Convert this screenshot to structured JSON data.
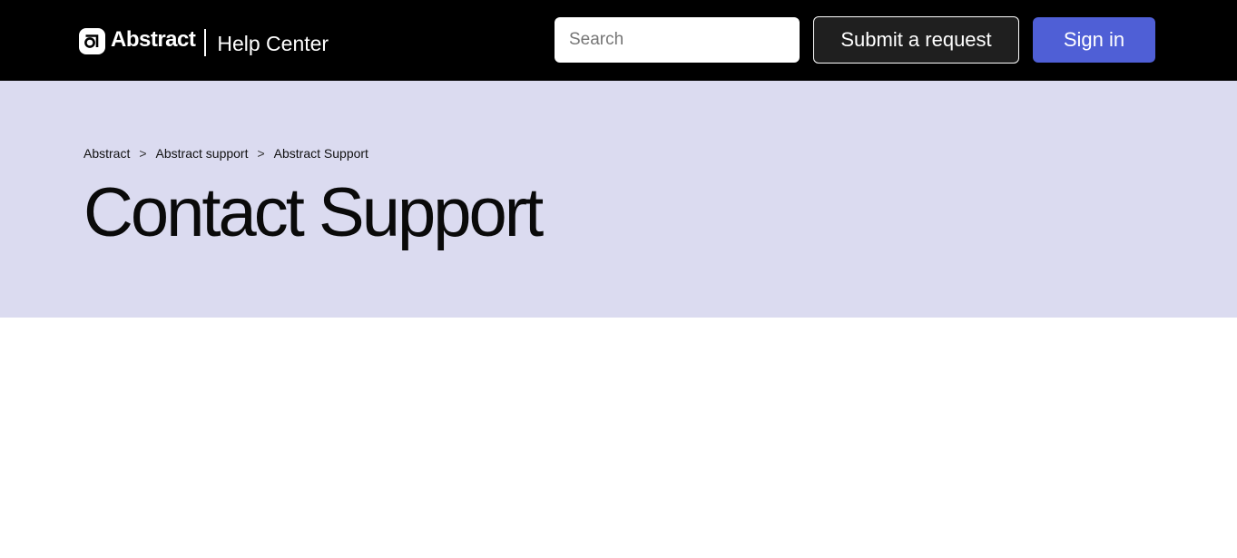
{
  "header": {
    "brand_name": "Abstract",
    "site_name": "Help Center",
    "search": {
      "placeholder": "Search",
      "value": ""
    },
    "submit_label": "Submit a request",
    "signin_label": "Sign in"
  },
  "breadcrumb": {
    "items": [
      {
        "label": "Abstract"
      },
      {
        "label": "Abstract support"
      },
      {
        "label": "Abstract Support"
      }
    ],
    "separator": ">"
  },
  "page": {
    "title": "Contact Support"
  },
  "colors": {
    "header_bg": "#000000",
    "hero_bg": "#dbdbf0",
    "signin_bg": "#4f5fd6",
    "submit_bg": "#1f1f1f"
  }
}
